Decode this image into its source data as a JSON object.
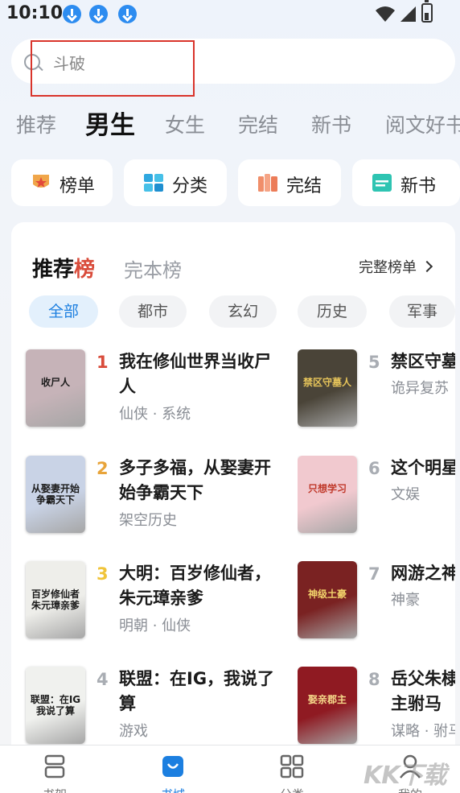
{
  "status_bar": {
    "time": "10:10"
  },
  "search": {
    "placeholder": "斗破"
  },
  "top_tabs": [
    "推荐",
    "男生",
    "女生",
    "完结",
    "新书",
    "阅文好书"
  ],
  "active_tab": "男生",
  "shortcuts": [
    {
      "label": "榜单",
      "icon": "trophy-icon"
    },
    {
      "label": "分类",
      "icon": "grid-icon"
    },
    {
      "label": "完结",
      "icon": "books-icon"
    },
    {
      "label": "新书",
      "icon": "new-book-icon"
    }
  ],
  "ranking": {
    "title_a": "推荐",
    "title_b": "榜",
    "subtitle": "完本榜",
    "full_link": "完整榜单",
    "chips": [
      "全部",
      "都市",
      "玄幻",
      "历史",
      "军事"
    ],
    "books": [
      {
        "rank": "1",
        "title": "我在修仙世界当收尸人",
        "meta": "仙侠 · 系统",
        "cover_text": "收尸人",
        "cover_color": "#c6b3b8"
      },
      {
        "rank": "2",
        "title": "多子多福，从娶妻开始争霸天下",
        "meta": "架空历史",
        "cover_text": "从娶妻开始争霸天下",
        "cover_color": "#c9d3e6"
      },
      {
        "rank": "3",
        "title": "大明：百岁修仙者，朱元璋亲爹",
        "meta": "明朝 · 仙侠",
        "cover_text": "百岁修仙者朱元璋亲爹",
        "cover_color": "#eeeeea"
      },
      {
        "rank": "4",
        "title": "联盟：在IG，我说了算",
        "meta": "游戏",
        "cover_text": "联盟：在IG我说了算",
        "cover_color": "#f0f1ee"
      },
      {
        "rank": "5",
        "title": "禁区守墓人",
        "meta": "诡异复苏",
        "cover_text": "禁区守墓人",
        "cover_color": "#4a4438"
      },
      {
        "rank": "6",
        "title": "这个明星不太冷",
        "meta": "文娱",
        "cover_text": "只想学习",
        "cover_color": "#f1c9cf"
      },
      {
        "rank": "7",
        "title": "网游之神级土豪",
        "meta": "神豪",
        "cover_text": "神级土豪",
        "cover_color": "#7a2222"
      },
      {
        "rank": "8",
        "title": "岳父朱棣，我是容郡主驸马",
        "meta": "谋略 · 驸马",
        "cover_text": "娶亲郡主",
        "cover_color": "#8f1a22"
      }
    ]
  },
  "bottom_nav": [
    {
      "label": "书架",
      "icon": "bookshelf-icon"
    },
    {
      "label": "书城",
      "icon": "store-icon"
    },
    {
      "label": "分类",
      "icon": "category-icon"
    },
    {
      "label": "我的",
      "icon": "profile-icon"
    }
  ],
  "watermark": "KK下载",
  "colors": {
    "accent": "#1c7fe0",
    "rank_red": "#d94c3b",
    "rank_gold": "#e8a43a",
    "rank_yellow": "#f0c43a",
    "highlight": "#d9342b"
  }
}
